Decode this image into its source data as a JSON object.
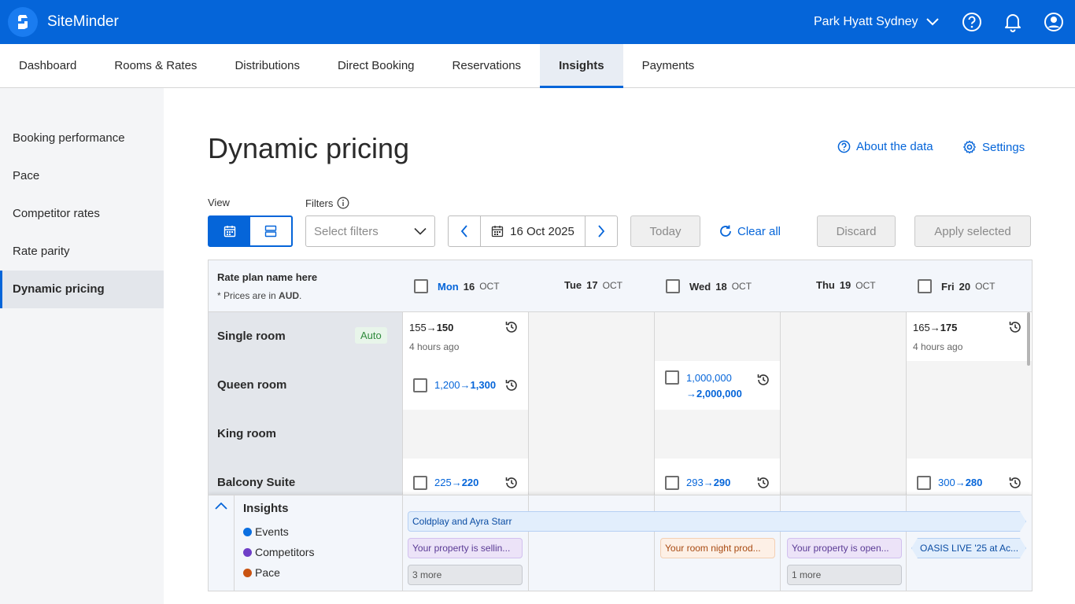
{
  "app": {
    "name": "SiteMinder",
    "property": "Park Hyatt Sydney"
  },
  "nav": [
    "Dashboard",
    "Rooms & Rates",
    "Distributions",
    "Direct Booking",
    "Reservations",
    "Insights",
    "Payments"
  ],
  "sidebar": [
    "Booking performance",
    "Pace",
    "Competitor rates",
    "Rate parity",
    "Dynamic pricing"
  ],
  "page": {
    "title": "Dynamic pricing",
    "about": "About the data",
    "settings": "Settings"
  },
  "toolbar": {
    "view_label": "View",
    "filters_label": "Filters",
    "filters_placeholder": "Select filters",
    "date": "16 Oct 2025",
    "today": "Today",
    "clear_all": "Clear all",
    "discard": "Discard",
    "apply": "Apply selected"
  },
  "grid": {
    "rate_plan_title": "Rate plan name here",
    "rate_note_prefix": "* Prices are in ",
    "currency": "AUD",
    "days": [
      {
        "dow": "Mon",
        "day": "16",
        "month": "OCT"
      },
      {
        "dow": "Tue",
        "day": "17",
        "month": "OCT"
      },
      {
        "dow": "Wed",
        "day": "18",
        "month": "OCT"
      },
      {
        "dow": "Thu",
        "day": "19",
        "month": "OCT"
      },
      {
        "dow": "Fri",
        "day": "20",
        "month": "OCT"
      }
    ],
    "rows": [
      {
        "name": "Single room",
        "badge": "Auto",
        "mon": {
          "from": "155",
          "to": "150",
          "ago": "4 hours ago"
        },
        "fri": {
          "from": "165",
          "to": "175",
          "ago": "4 hours ago"
        }
      },
      {
        "name": "Queen room",
        "mon": {
          "from": "1,200",
          "to": "1,300"
        },
        "wed": {
          "from": "1,000,000",
          "to": "2,000,000"
        }
      },
      {
        "name": "King room"
      },
      {
        "name": "Balcony Suite",
        "mon": {
          "from": "225",
          "to": "220"
        },
        "wed": {
          "from": "293",
          "to": "290"
        },
        "fri": {
          "from": "300",
          "to": "280"
        }
      }
    ]
  },
  "insights": {
    "title": "Insights",
    "legend": [
      {
        "label": "Events",
        "color": "#0b6fe0"
      },
      {
        "label": "Competitors",
        "color": "#6f3fc7"
      },
      {
        "label": "Pace",
        "color": "#c95312"
      }
    ],
    "chips": {
      "event_span": "Coldplay and Ayra Starr",
      "mon_comp": "Your property is sellin...",
      "mon_more": "3 more",
      "wed_pace": "Your room night prod...",
      "thu_comp": "Your property is open...",
      "thu_more": "1 more",
      "fri_event": "OASIS LIVE '25 at Ac..."
    }
  }
}
